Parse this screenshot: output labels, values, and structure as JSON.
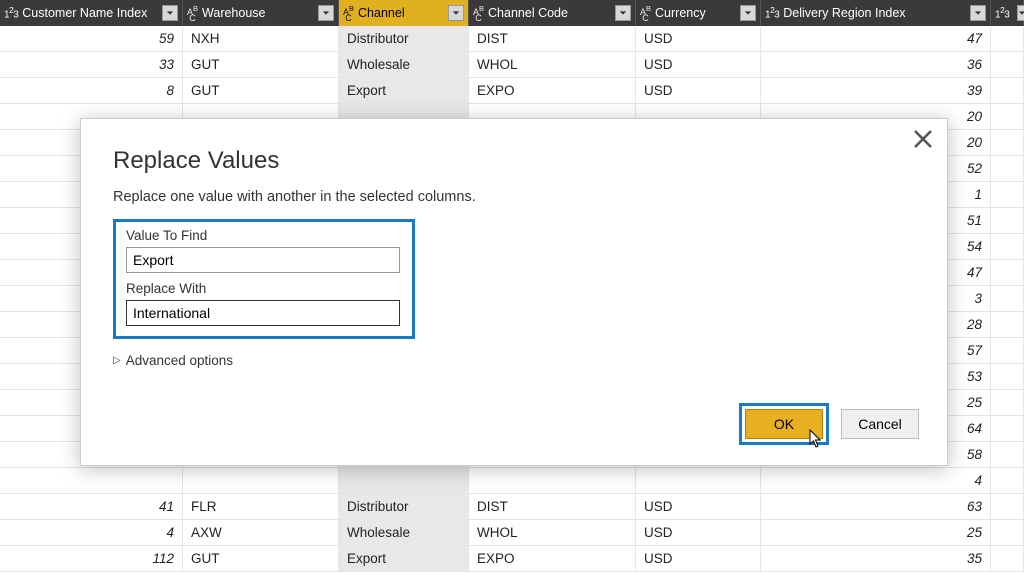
{
  "columns": [
    {
      "label": "Customer Name Index",
      "type": "num"
    },
    {
      "label": "Warehouse",
      "type": "text"
    },
    {
      "label": "Channel",
      "type": "text",
      "selected": true
    },
    {
      "label": "Channel Code",
      "type": "text"
    },
    {
      "label": "Currency",
      "type": "text"
    },
    {
      "label": "Delivery Region Index",
      "type": "num"
    },
    {
      "label": "",
      "type": "num"
    }
  ],
  "rows": [
    {
      "idx": "59",
      "wh": "NXH",
      "ch": "Distributor",
      "code": "DIST",
      "cur": "USD",
      "reg": "47"
    },
    {
      "idx": "33",
      "wh": "GUT",
      "ch": "Wholesale",
      "code": "WHOL",
      "cur": "USD",
      "reg": "36"
    },
    {
      "idx": "8",
      "wh": "GUT",
      "ch": "Export",
      "code": "EXPO",
      "cur": "USD",
      "reg": "39"
    },
    {
      "idx": "",
      "wh": "",
      "ch": "",
      "code": "",
      "cur": "",
      "reg": "20"
    },
    {
      "idx": "",
      "wh": "",
      "ch": "",
      "code": "",
      "cur": "",
      "reg": "20"
    },
    {
      "idx": "",
      "wh": "",
      "ch": "",
      "code": "",
      "cur": "",
      "reg": "52"
    },
    {
      "idx": "",
      "wh": "",
      "ch": "",
      "code": "",
      "cur": "",
      "reg": "1"
    },
    {
      "idx": "",
      "wh": "",
      "ch": "",
      "code": "",
      "cur": "",
      "reg": "51"
    },
    {
      "idx": "",
      "wh": "",
      "ch": "",
      "code": "",
      "cur": "",
      "reg": "54"
    },
    {
      "idx": "",
      "wh": "",
      "ch": "",
      "code": "",
      "cur": "",
      "reg": "47"
    },
    {
      "idx": "",
      "wh": "",
      "ch": "",
      "code": "",
      "cur": "",
      "reg": "3"
    },
    {
      "idx": "",
      "wh": "",
      "ch": "",
      "code": "",
      "cur": "",
      "reg": "28"
    },
    {
      "idx": "",
      "wh": "",
      "ch": "",
      "code": "",
      "cur": "",
      "reg": "57"
    },
    {
      "idx": "",
      "wh": "",
      "ch": "",
      "code": "",
      "cur": "",
      "reg": "53"
    },
    {
      "idx": "",
      "wh": "",
      "ch": "",
      "code": "",
      "cur": "",
      "reg": "25"
    },
    {
      "idx": "",
      "wh": "",
      "ch": "",
      "code": "",
      "cur": "",
      "reg": "64"
    },
    {
      "idx": "",
      "wh": "",
      "ch": "",
      "code": "",
      "cur": "",
      "reg": "58"
    },
    {
      "idx": "",
      "wh": "",
      "ch": "",
      "code": "",
      "cur": "",
      "reg": "4"
    },
    {
      "idx": "41",
      "wh": "FLR",
      "ch": "Distributor",
      "code": "DIST",
      "cur": "USD",
      "reg": "63"
    },
    {
      "idx": "4",
      "wh": "AXW",
      "ch": "Wholesale",
      "code": "WHOL",
      "cur": "USD",
      "reg": "25"
    },
    {
      "idx": "112",
      "wh": "GUT",
      "ch": "Export",
      "code": "EXPO",
      "cur": "USD",
      "reg": "35"
    }
  ],
  "dialog": {
    "title": "Replace Values",
    "subtitle": "Replace one value with another in the selected columns.",
    "find_label": "Value To Find",
    "find_value": "Export",
    "replace_label": "Replace With",
    "replace_value": "International",
    "advanced": "Advanced options",
    "ok": "OK",
    "cancel": "Cancel"
  }
}
